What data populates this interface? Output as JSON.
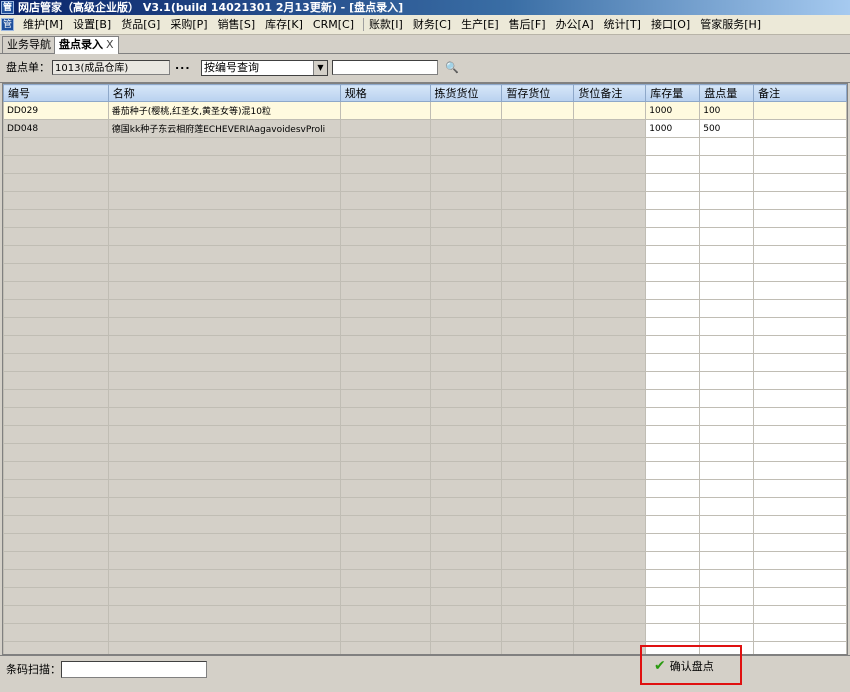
{
  "window": {
    "title": "网店管家（高级企业版） V3.1(build 14021301 2月13更新) - [盘点录入]",
    "app_icon": "管"
  },
  "menu": [
    "维护[M]",
    "设置[B]",
    "货品[G]",
    "采购[P]",
    "销售[S]",
    "库存[K]",
    "CRM[C]",
    "账款[I]",
    "财务[C]",
    "生产[E]",
    "售后[F]",
    "办公[A]",
    "统计[T]",
    "接口[O]",
    "管家服务[H]"
  ],
  "tabs": [
    {
      "label": "业务导航",
      "active": false
    },
    {
      "label": "盘点录入",
      "active": true,
      "close": "X"
    }
  ],
  "toolbar": {
    "count_label": "盘点单：",
    "count_value": "1013(成品仓库)",
    "browse_button": "...",
    "query_mode": "按编号查询",
    "search_value": ""
  },
  "grid": {
    "columns": [
      "编号",
      "名称",
      "规格",
      "拣货货位",
      "暂存货位",
      "货位备注",
      "库存量",
      "盘点量",
      "备注"
    ],
    "rows": [
      {
        "code": "DD029",
        "name": "番茄种子(樱桃,红圣女,黄圣女等)混10粒",
        "spec": "",
        "pick": "",
        "temp": "",
        "loc_note": "",
        "stock": "1000",
        "counted": "100",
        "note": ""
      },
      {
        "code": "DD048",
        "name": "德国kk种子东云相府莲ECHEVERIAagavoidesvProli",
        "spec": "",
        "pick": "",
        "temp": "",
        "loc_note": "",
        "stock": "1000",
        "counted": "500",
        "note": ""
      }
    ]
  },
  "bottom": {
    "barcode_label": "条码扫描：",
    "barcode_value": "",
    "confirm_label": "确认盘点"
  },
  "icons": [
    "app-icon",
    "check-icon",
    "search-icon",
    "dropdown-arrow-icon"
  ]
}
